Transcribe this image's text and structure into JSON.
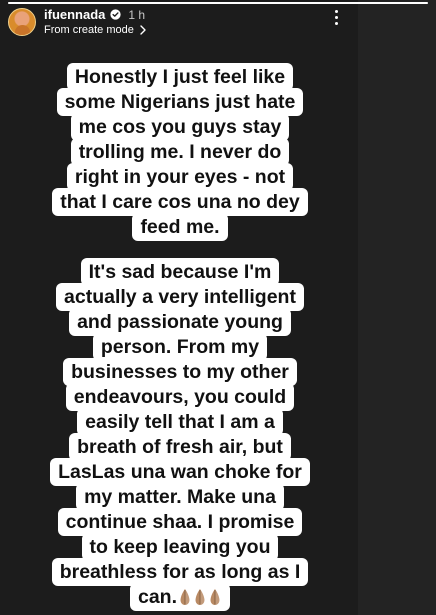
{
  "story": {
    "progress_fraction": 1.0
  },
  "header": {
    "username": "ifuennada",
    "time_ago": "1 h",
    "mode_label": "From create mode",
    "icons": {
      "verified": "verified-badge-icon",
      "chevron": "chevron-right-icon",
      "more": "more-vertical-icon"
    }
  },
  "text_blocks": [
    {
      "lines": [
        "Honestly I just feel like",
        "some  Nigerians just hate",
        "me cos you guys stay",
        "trolling me. I never do",
        "right in your eyes - not",
        "that I care cos una no dey",
        "feed me."
      ]
    },
    {
      "lines": [
        "It's sad because I'm",
        "actually a very intelligent",
        "and passionate young",
        "person. From my",
        "businesses to my other",
        "endeavours, you could",
        "easily tell that I am a",
        "breath of fresh air, but",
        "LasLas una wan choke for",
        "my matter. Make una",
        "continue shaa. I promise",
        "to keep leaving you",
        "breathless for as long as I",
        "can."
      ],
      "trailing_emoji": "praying-hands-icon"
    }
  ],
  "colors": {
    "background": "#1c1c1c",
    "caption_bg": "#ffffff",
    "caption_text": "#111111",
    "verified_blue": "#3897f0",
    "emoji_skin": "#b98a64"
  }
}
